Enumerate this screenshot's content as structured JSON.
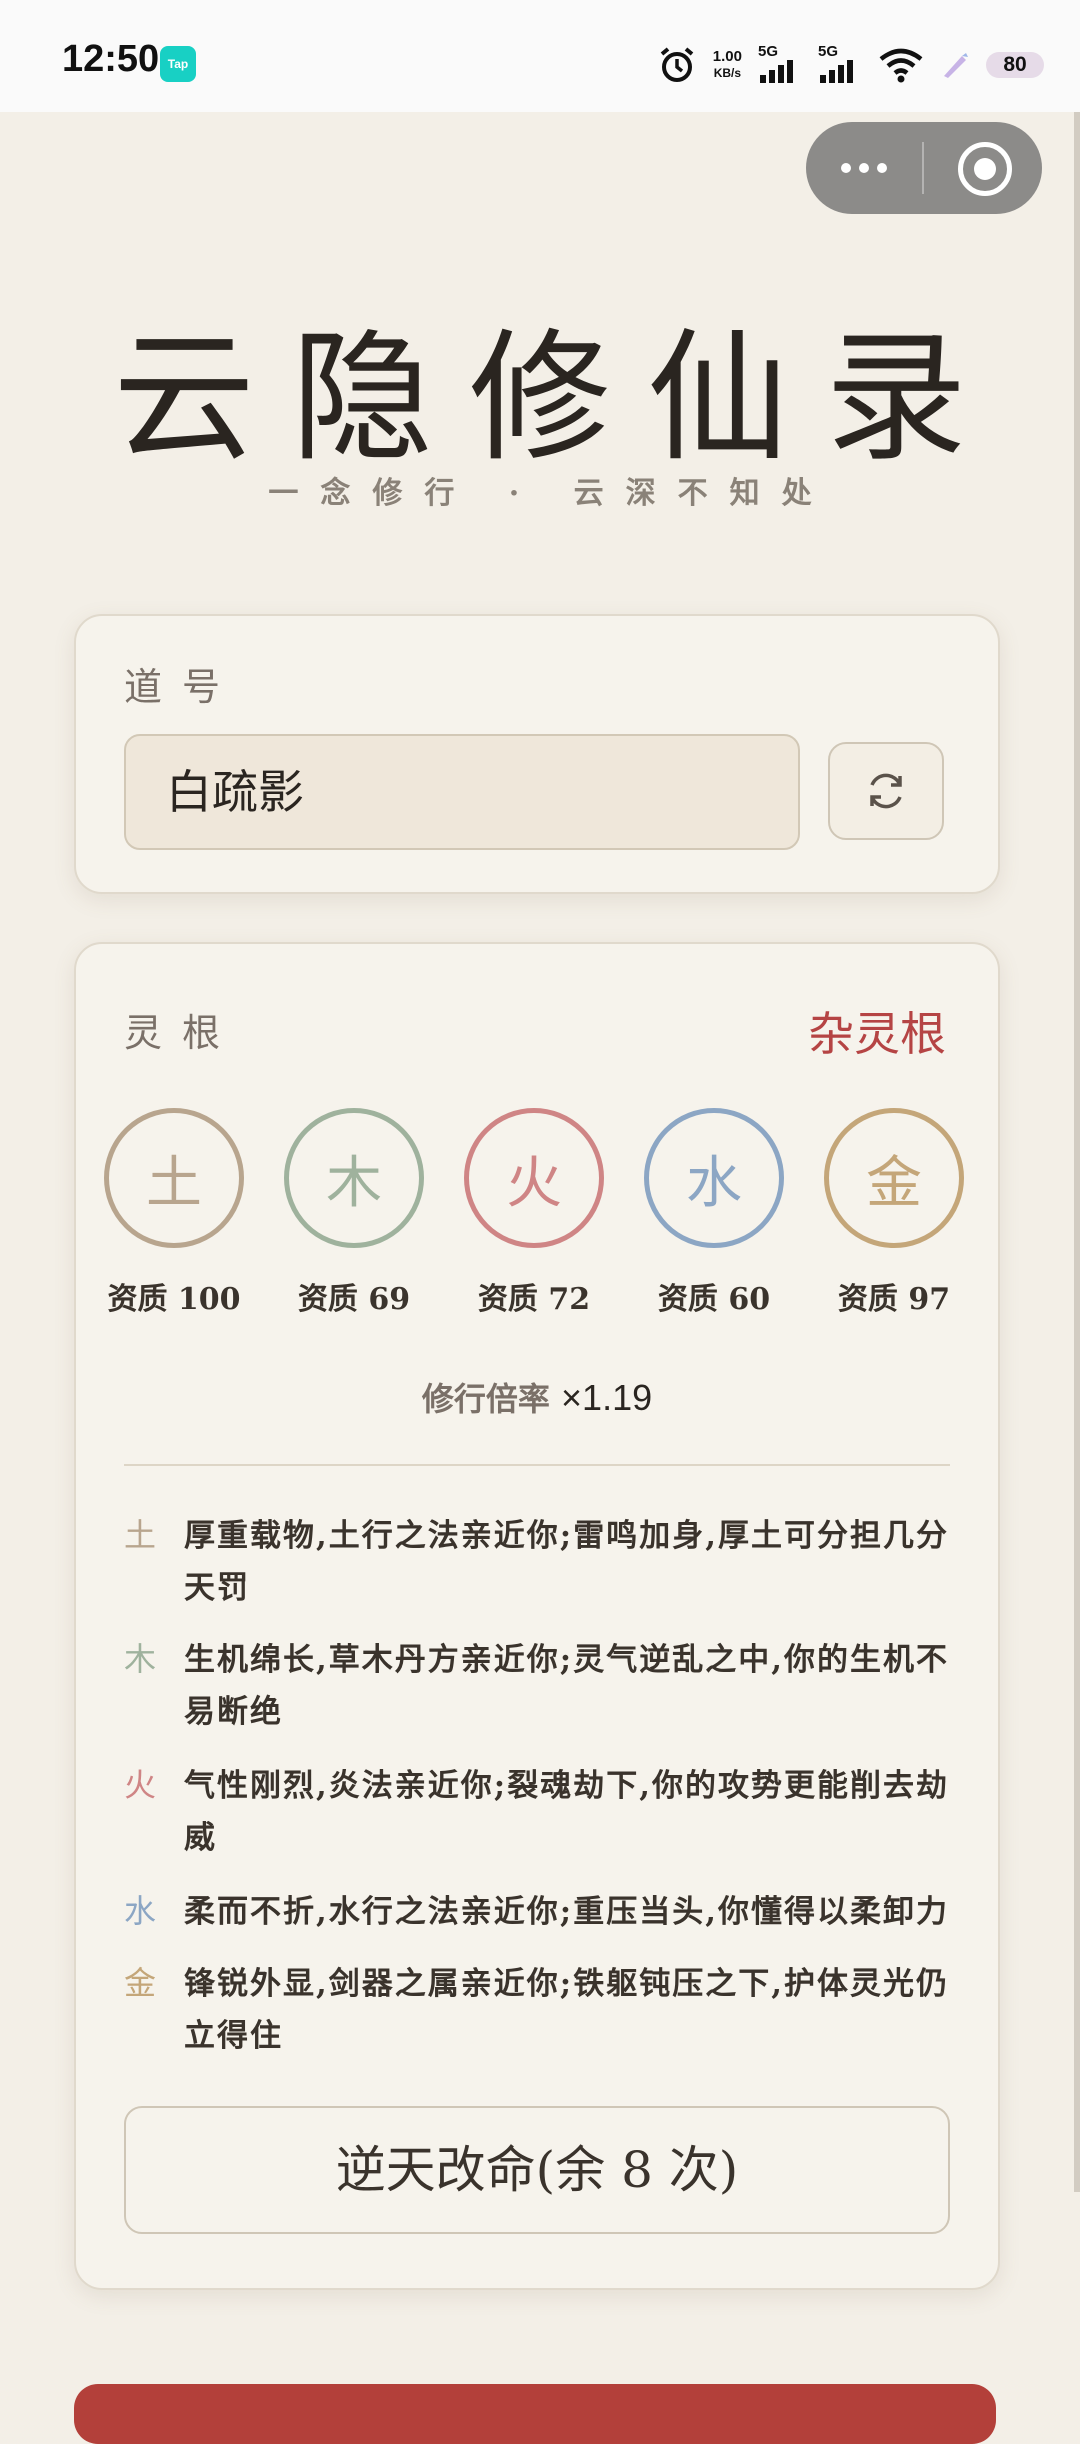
{
  "status_bar": {
    "time": "12:50",
    "app_badge": "Tap",
    "net_speed_value": "1.00",
    "net_speed_unit": "KB/s",
    "sim1": "5G",
    "sim2": "5G",
    "battery": "80"
  },
  "header": {
    "title": "云隐修仙录",
    "subtitle": "一念修行 · 云深不知处"
  },
  "daohao": {
    "label": "道号",
    "value": "白疏影"
  },
  "linggen": {
    "label": "灵根",
    "type": "杂灵根",
    "elements": [
      {
        "char": "土",
        "aptitude": "资质 100",
        "color": "#b8a58e"
      },
      {
        "char": "木",
        "aptitude": "资质 69",
        "color": "#9fb29d"
      },
      {
        "char": "火",
        "aptitude": "资质 72",
        "color": "#cf8585"
      },
      {
        "char": "水",
        "aptitude": "资质 60",
        "color": "#8ca6c4"
      },
      {
        "char": "金",
        "aptitude": "资质 97",
        "color": "#c4a679"
      }
    ],
    "rate_label": "修行倍率",
    "rate_value": "×1.19",
    "descriptions": [
      {
        "char": "土",
        "text": "厚重载物,土行之法亲近你;雷鸣加身,厚土可分担几分天罚"
      },
      {
        "char": "木",
        "text": "生机绵长,草木丹方亲近你;灵气逆乱之中,你的生机不易断绝"
      },
      {
        "char": "火",
        "text": "气性刚烈,炎法亲近你;裂魂劫下,你的攻势更能削去劫威"
      },
      {
        "char": "水",
        "text": "柔而不折,水行之法亲近你;重压当头,你懂得以柔卸力"
      },
      {
        "char": "金",
        "text": "锋锐外显,剑器之属亲近你;铁躯钝压之下,护体灵光仍立得住"
      }
    ],
    "reroll_button": "逆天改命(余 8 次)"
  }
}
